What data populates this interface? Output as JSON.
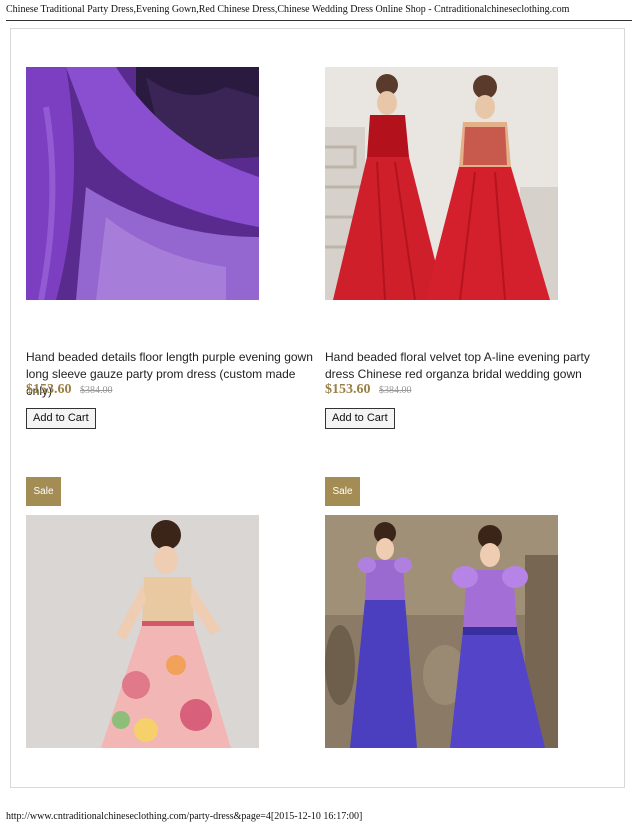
{
  "header": {
    "title": "Chinese Traditional Party Dress,Evening Gown,Red Chinese Dress,Chinese Wedding Dress Online Shop - Cntraditionalchineseclothing.com"
  },
  "products": [
    {
      "title": "Hand beaded details floor length purple evening gown long sleeve gauze party prom dress (custom made only)",
      "price": "$153.60",
      "old_price": "$384.00",
      "button_label": "Add to Cart",
      "image_alt": "purple evening gown"
    },
    {
      "title": "Hand beaded floral velvet top A-line evening party dress Chinese red organza bridal wedding gown",
      "price": "$153.60",
      "old_price": "$384.00",
      "button_label": "Add to Cart",
      "image_alt": "red bridal wedding gown"
    },
    {
      "badge": "Sale",
      "image_alt": "floral evening dress"
    },
    {
      "badge": "Sale",
      "image_alt": "purple satin evening dress"
    }
  ],
  "footer": {
    "url": "http://www.cntraditionalchineseclothing.com/party-dress&page=4[2015-12-10 16:17:00]"
  }
}
